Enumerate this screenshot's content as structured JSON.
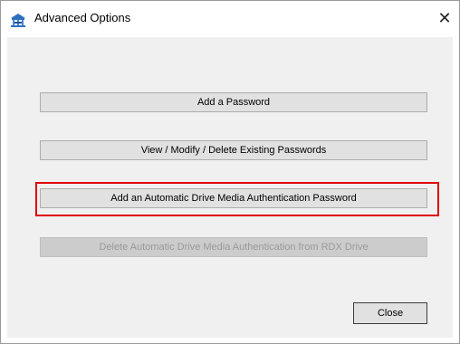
{
  "window": {
    "title": "Advanced Options",
    "close_glyph": "✕"
  },
  "icons": {
    "app_icon": "drive-key-icon",
    "close_icon": "close-icon"
  },
  "buttons": {
    "add_password": "Add a Password",
    "view_modify_delete": "View / Modify / Delete Existing Passwords",
    "add_auto_auth": "Add an Automatic Drive Media Authentication Password",
    "delete_auto_auth": "Delete Automatic Drive Media Authentication from RDX Drive",
    "close": "Close"
  },
  "states": {
    "delete_auto_auth_enabled": false,
    "highlighted_option": "add_auto_auth"
  },
  "colors": {
    "highlight": "#e00000",
    "dialog_background": "#f0f0f0",
    "button_face": "#e1e1e1",
    "disabled_text": "#9a9a9a"
  }
}
